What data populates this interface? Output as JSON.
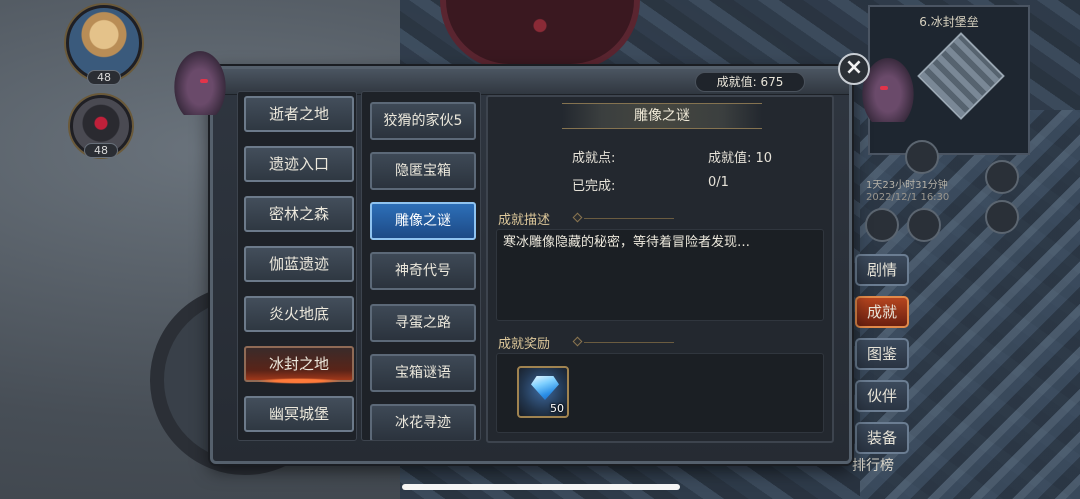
{
  "score": {
    "label": "成就值",
    "value": "675",
    "text": "成就值: 675"
  },
  "party": [
    {
      "level": "48"
    },
    {
      "level": "48"
    }
  ],
  "minimap": {
    "title": "6.冰封堡垒"
  },
  "side_info": {
    "timer": "1天23小时31分钟",
    "date": "2022/12/1 16:30"
  },
  "side_menu": [
    {
      "label": "剧情",
      "active": false
    },
    {
      "label": "成就",
      "active": true
    },
    {
      "label": "图鉴",
      "active": false
    },
    {
      "label": "伙伴",
      "active": false
    },
    {
      "label": "装备",
      "active": false
    }
  ],
  "rank_label": "排行榜",
  "regions": [
    {
      "label": "逝者之地"
    },
    {
      "label": "遗迹入口"
    },
    {
      "label": "密林之森"
    },
    {
      "label": "伽蓝遗迹"
    },
    {
      "label": "炎火地底"
    },
    {
      "label": "冰封之地",
      "active": true
    },
    {
      "label": "幽冥城堡"
    }
  ],
  "achievements": [
    {
      "label": "狡猾的家伙5"
    },
    {
      "label": "隐匿宝箱"
    },
    {
      "label": "雕像之谜",
      "active": true
    },
    {
      "label": "神奇代号"
    },
    {
      "label": "寻蛋之路"
    },
    {
      "label": "宝箱谜语"
    },
    {
      "label": "冰花寻迹"
    }
  ],
  "detail": {
    "title": "雕像之谜",
    "points_label": "成就点:",
    "value_label": "成就值: 10",
    "completed_label": "已完成:",
    "completed_value": "0/1",
    "desc_heading": "成就描述",
    "description": "寒冰雕像隐藏的秘密，等待着冒险者发现…",
    "reward_heading": "成就奖励",
    "reward": {
      "icon": "diamond-gem-icon",
      "count": "50"
    }
  },
  "close_icon": "close-icon"
}
